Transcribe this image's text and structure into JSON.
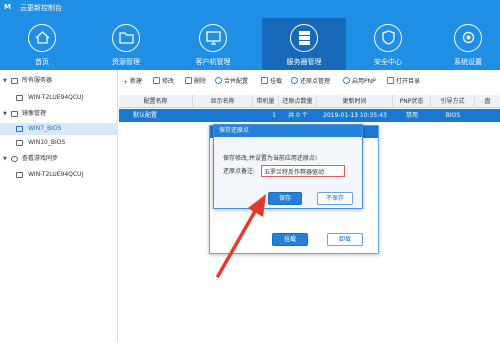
{
  "app": {
    "logo": "M",
    "title": "云更新控制台"
  },
  "nav": [
    {
      "label": "首页",
      "icon": "home-icon"
    },
    {
      "label": "资源管理",
      "icon": "folder-icon"
    },
    {
      "label": "客户机管理",
      "icon": "monitor-icon"
    },
    {
      "label": "服务器管理",
      "icon": "server-icon",
      "active": true
    },
    {
      "label": "安全中心",
      "icon": "shield-icon"
    },
    {
      "label": "系统设置",
      "icon": "gear-icon"
    }
  ],
  "sidebar": {
    "items": [
      {
        "label": "所有服务器",
        "icon": "server-group-icon"
      },
      {
        "label": "WIN-T2LUE94QCUJ",
        "icon": "pc-icon"
      },
      {
        "label": "镜像管理",
        "icon": "image-group-icon"
      },
      {
        "label": "WIN7_BIOS",
        "icon": "image-icon",
        "selected": true
      },
      {
        "label": "WIN10_BIOS",
        "icon": "image-icon"
      },
      {
        "label": "查看游戏同步",
        "icon": "sync-icon"
      },
      {
        "label": "WIN-T2LUE94QCUJ",
        "icon": "pc-icon"
      }
    ]
  },
  "toolbar": {
    "items": [
      {
        "label": "新建",
        "icon": "plus-icon"
      },
      {
        "label": "修改",
        "icon": "edit-icon"
      },
      {
        "label": "删除",
        "icon": "delete-icon"
      },
      {
        "label": "合并配置",
        "icon": "merge-icon"
      },
      {
        "label": "挂载",
        "icon": "mount-icon"
      },
      {
        "label": "还原点管理",
        "icon": "restore-icon"
      },
      {
        "label": "启用PNP",
        "icon": "pnp-icon"
      },
      {
        "label": "打开目录",
        "icon": "open-folder-icon"
      }
    ]
  },
  "table": {
    "columns": [
      "配置名称",
      "显示名称",
      "带机量",
      "还原点数量",
      "更新时间",
      "PNP状态",
      "引导方式",
      "盘"
    ],
    "rows": [
      {
        "name": "默认配置",
        "display": "",
        "count": "1",
        "restore": "共 0 个",
        "time": "2019-01-13 10:35:43",
        "pnp": "禁用",
        "boot": "BIOS",
        "disk": ""
      }
    ]
  },
  "dialog": {
    "title": "保存还原点",
    "message": "保存修改,并设置为当前应用还原点!",
    "field_label": "还原点备注:",
    "field_value": "五罗兰特反作弊器驱动",
    "save": "保存",
    "nosave": "不保存"
  },
  "dialog_back": {
    "mount": "挂载",
    "unmount": "卸载"
  },
  "colors": {
    "brand": "#1f8fe6",
    "active_nav": "#1769b9",
    "selection": "#1a78d2",
    "annotation_arrow": "#e23b2e"
  }
}
